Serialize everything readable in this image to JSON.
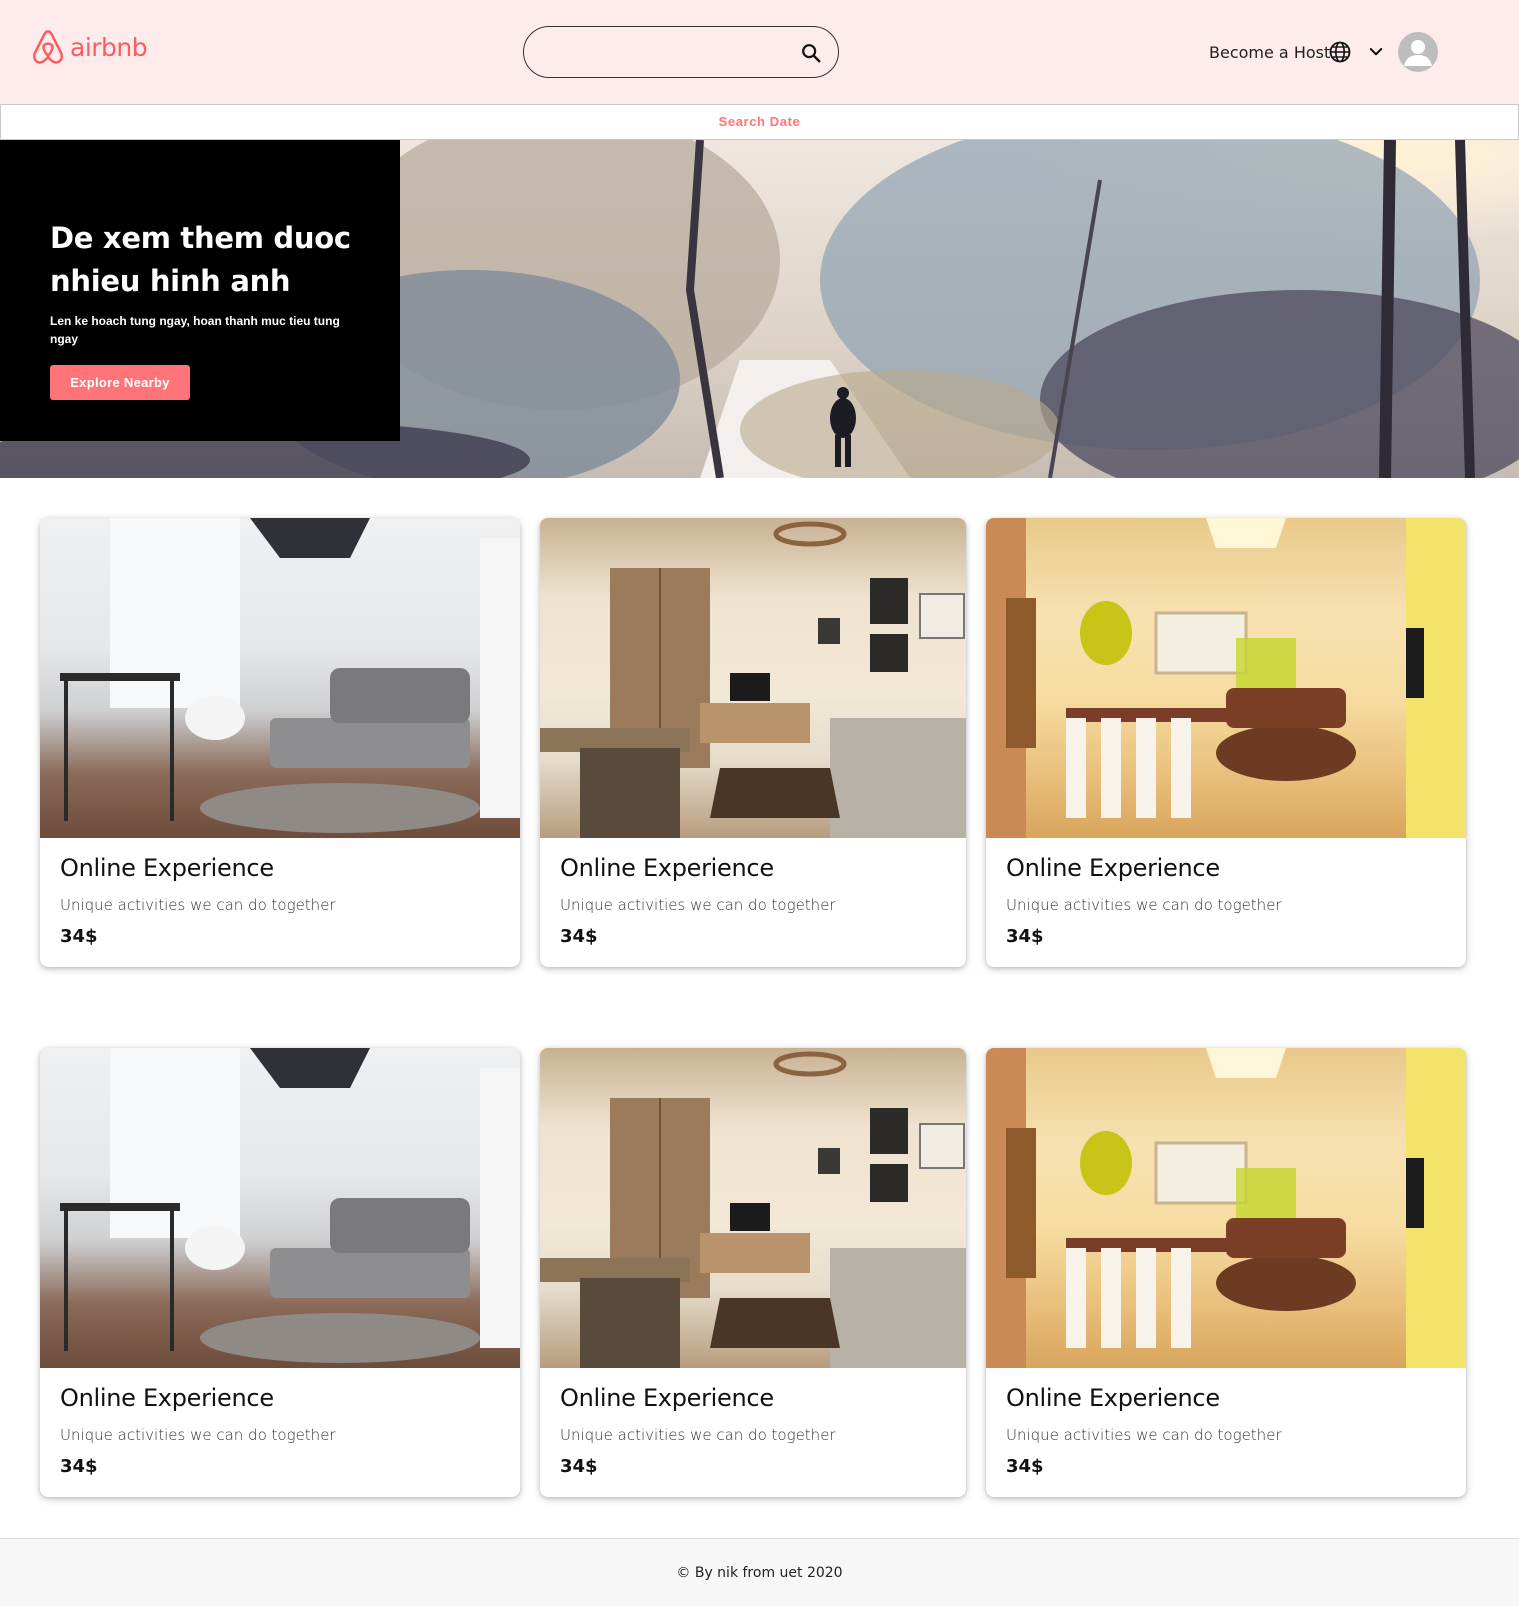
{
  "header": {
    "brand": "airbnb",
    "logo_icon": "airbnb-logo-icon",
    "search_placeholder": "",
    "search_icon": "search-icon",
    "host_label": "Become a Host",
    "globe_icon": "globe-icon",
    "menu_icon": "chevron-down-icon",
    "avatar_icon": "user-avatar-icon"
  },
  "date_bar": {
    "label": "Search Date"
  },
  "hero": {
    "title": "De xem them duoc nhieu hinh anh",
    "subtitle": "Len ke hoach tung ngay, hoan thanh muc tieu tung ngay",
    "button_label": "Explore Nearby"
  },
  "cards": [
    {
      "title": "Online Experience",
      "description": "Unique activities we can do together",
      "price": "34$"
    },
    {
      "title": "Online Experience",
      "description": "Unique activities we can do together",
      "price": "34$"
    },
    {
      "title": "Online Experience",
      "description": "Unique activities we can do together",
      "price": "34$"
    },
    {
      "title": "Online Experience",
      "description": "Unique activities we can do together",
      "price": "34$"
    },
    {
      "title": "Online Experience",
      "description": "Unique activities we can do together",
      "price": "34$"
    },
    {
      "title": "Online Experience",
      "description": "Unique activities we can do together",
      "price": "34$"
    }
  ],
  "footer": {
    "text": "© By nik from uet 2020"
  },
  "colors": {
    "brand": "#ff5a5f",
    "header_bg": "#fdeceb",
    "accent": "#ff7478"
  }
}
